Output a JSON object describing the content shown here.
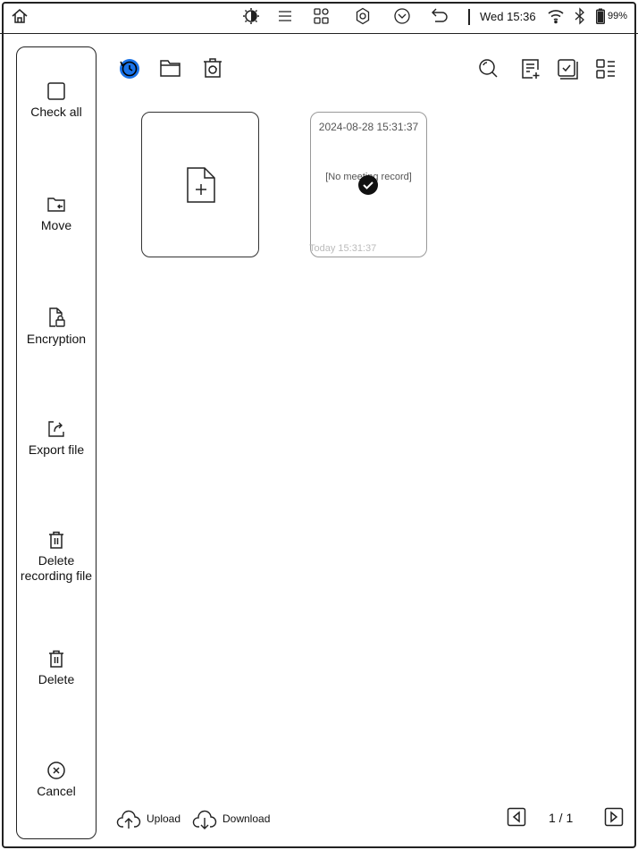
{
  "status_bar": {
    "icons": [
      "home-icon",
      "brightness-icon",
      "list-icon",
      "apps-icon",
      "settings-icon",
      "dropdown-icon",
      "back-icon",
      "wifi-icon",
      "bluetooth-icon",
      "battery-icon"
    ],
    "time": "Wed 15:36",
    "battery": "99%",
    "battery_level": 0.99
  },
  "sidebar": {
    "items": [
      {
        "label": "Check all",
        "icon": "checkbox-icon"
      },
      {
        "label": "Move",
        "icon": "folder-move-icon"
      },
      {
        "label": "Encryption",
        "icon": "file-lock-icon"
      },
      {
        "label": "Export file",
        "icon": "export-icon"
      },
      {
        "label": "Delete\nrecording file",
        "icon": "trash-icon"
      },
      {
        "label": "Delete",
        "icon": "trash-icon"
      },
      {
        "label": "Cancel",
        "icon": "close-circle-icon"
      }
    ]
  },
  "toolbar": {
    "left_icons": [
      "recent-icon",
      "folder-icon",
      "recycle-bin-icon"
    ],
    "right_icons": [
      "search-icon",
      "new-note-icon",
      "multi-select-icon",
      "view-mode-icon"
    ],
    "accent_color": "#1a73e8"
  },
  "cards": {
    "new_card_icon": "new-file-icon",
    "recording": {
      "title": "2024-08-28 15:31:37",
      "body": "[No meeting record]",
      "date": "Today 15:31:37",
      "selected": true
    }
  },
  "bottom": {
    "upload_label": "Upload",
    "download_label": "Download",
    "page": "1 / 1"
  }
}
